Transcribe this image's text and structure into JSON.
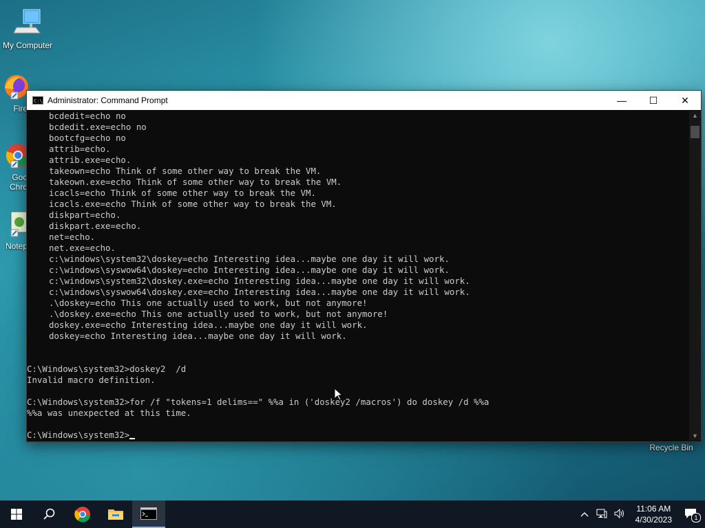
{
  "desktop": {
    "icons": [
      {
        "name": "my-computer",
        "label": "My Computer"
      },
      {
        "name": "firefox",
        "label": "Fire"
      },
      {
        "name": "chrome",
        "label": "Goo\nChro"
      },
      {
        "name": "notepad",
        "label": "Notep"
      },
      {
        "name": "recycle-bin",
        "label": "Recycle Bin"
      }
    ]
  },
  "window": {
    "title": "Administrator: Command Prompt",
    "icon_text": "C:\\_",
    "minimize_symbol": "—",
    "maximize_symbol": "☐",
    "close_symbol": "✕"
  },
  "console": {
    "lines": [
      {
        "indent": true,
        "text": "bcdedit=echo no"
      },
      {
        "indent": true,
        "text": "bcdedit.exe=echo no"
      },
      {
        "indent": true,
        "text": "bootcfg=echo no"
      },
      {
        "indent": true,
        "text": "attrib=echo."
      },
      {
        "indent": true,
        "text": "attrib.exe=echo."
      },
      {
        "indent": true,
        "text": "takeown=echo Think of some other way to break the VM."
      },
      {
        "indent": true,
        "text": "takeown.exe=echo Think of some other way to break the VM."
      },
      {
        "indent": true,
        "text": "icacls=echo Think of some other way to break the VM."
      },
      {
        "indent": true,
        "text": "icacls.exe=echo Think of some other way to break the VM."
      },
      {
        "indent": true,
        "text": "diskpart=echo."
      },
      {
        "indent": true,
        "text": "diskpart.exe=echo."
      },
      {
        "indent": true,
        "text": "net=echo."
      },
      {
        "indent": true,
        "text": "net.exe=echo."
      },
      {
        "indent": true,
        "text": "c:\\windows\\system32\\doskey=echo Interesting idea...maybe one day it will work."
      },
      {
        "indent": true,
        "text": "c:\\windows\\syswow64\\doskey=echo Interesting idea...maybe one day it will work."
      },
      {
        "indent": true,
        "text": "c:\\windows\\system32\\doskey.exe=echo Interesting idea...maybe one day it will work."
      },
      {
        "indent": true,
        "text": "c:\\windows\\syswow64\\doskey.exe=echo Interesting idea...maybe one day it will work."
      },
      {
        "indent": true,
        "text": ".\\doskey=echo This one actually used to work, but not anymore!"
      },
      {
        "indent": true,
        "text": ".\\doskey.exe=echo This one actually used to work, but not anymore!"
      },
      {
        "indent": true,
        "text": "doskey.exe=echo Interesting idea...maybe one day it will work."
      },
      {
        "indent": true,
        "text": "doskey=echo Interesting idea...maybe one day it will work."
      },
      {
        "indent": false,
        "text": ""
      },
      {
        "indent": false,
        "text": ""
      },
      {
        "indent": false,
        "text": "C:\\Windows\\system32>doskey2  /d"
      },
      {
        "indent": false,
        "text": "Invalid macro definition."
      },
      {
        "indent": false,
        "text": ""
      },
      {
        "indent": false,
        "text": "C:\\Windows\\system32>for /f \"tokens=1 delims==\" %%a in ('doskey2 /macros') do doskey /d %%a"
      },
      {
        "indent": false,
        "text": "%%a was unexpected at this time."
      },
      {
        "indent": false,
        "text": ""
      }
    ],
    "prompt": "C:\\Windows\\system32>"
  },
  "taskbar": {
    "clock_time": "11:06 AM",
    "clock_date": "4/30/2023",
    "notification_count": "1"
  },
  "colors": {
    "console_bg": "#0c0c0c",
    "console_fg": "#cccccc",
    "taskbar_bg": "#101824"
  }
}
